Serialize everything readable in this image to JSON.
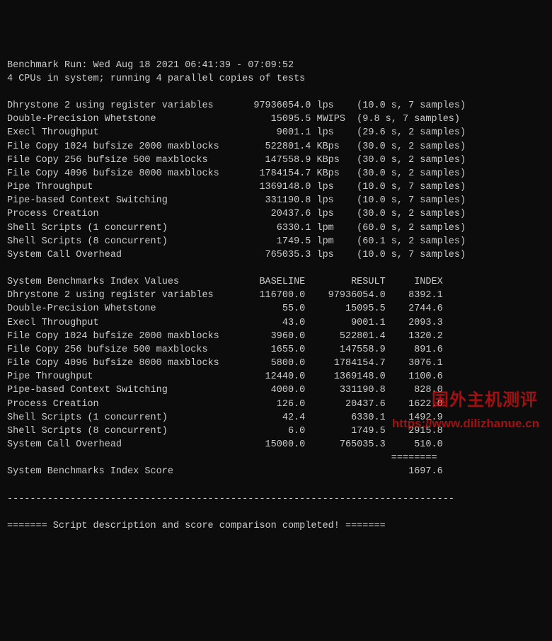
{
  "header": {
    "line1": "Benchmark Run: Wed Aug 18 2021 06:41:39 - 07:09:52",
    "line2": "4 CPUs in system; running 4 parallel copies of tests"
  },
  "separator": "------------------------------------------------------------------------",
  "tests": [
    {
      "name": "Dhrystone 2 using register variables",
      "value": "97936054.0",
      "unit": "lps",
      "timing": "(10.0 s, 7 samples)"
    },
    {
      "name": "Double-Precision Whetstone",
      "value": "15095.5",
      "unit": "MWIPS",
      "timing": "(9.8 s, 7 samples)"
    },
    {
      "name": "Execl Throughput",
      "value": "9001.1",
      "unit": "lps",
      "timing": "(29.6 s, 2 samples)"
    },
    {
      "name": "File Copy 1024 bufsize 2000 maxblocks",
      "value": "522801.4",
      "unit": "KBps",
      "timing": "(30.0 s, 2 samples)"
    },
    {
      "name": "File Copy 256 bufsize 500 maxblocks",
      "value": "147558.9",
      "unit": "KBps",
      "timing": "(30.0 s, 2 samples)"
    },
    {
      "name": "File Copy 4096 bufsize 8000 maxblocks",
      "value": "1784154.7",
      "unit": "KBps",
      "timing": "(30.0 s, 2 samples)"
    },
    {
      "name": "Pipe Throughput",
      "value": "1369148.0",
      "unit": "lps",
      "timing": "(10.0 s, 7 samples)"
    },
    {
      "name": "Pipe-based Context Switching",
      "value": "331190.8",
      "unit": "lps",
      "timing": "(10.0 s, 7 samples)"
    },
    {
      "name": "Process Creation",
      "value": "20437.6",
      "unit": "lps",
      "timing": "(30.0 s, 2 samples)"
    },
    {
      "name": "Shell Scripts (1 concurrent)",
      "value": "6330.1",
      "unit": "lpm",
      "timing": "(60.0 s, 2 samples)"
    },
    {
      "name": "Shell Scripts (8 concurrent)",
      "value": "1749.5",
      "unit": "lpm",
      "timing": "(60.1 s, 2 samples)"
    },
    {
      "name": "System Call Overhead",
      "value": "765035.3",
      "unit": "lps",
      "timing": "(10.0 s, 7 samples)"
    }
  ],
  "index_header": {
    "label": "System Benchmarks Index Values",
    "c1": "BASELINE",
    "c2": "RESULT",
    "c3": "INDEX"
  },
  "index_rows": [
    {
      "name": "Dhrystone 2 using register variables",
      "baseline": "116700.0",
      "result": "97936054.0",
      "index": "8392.1"
    },
    {
      "name": "Double-Precision Whetstone",
      "baseline": "55.0",
      "result": "15095.5",
      "index": "2744.6"
    },
    {
      "name": "Execl Throughput",
      "baseline": "43.0",
      "result": "9001.1",
      "index": "2093.3"
    },
    {
      "name": "File Copy 1024 bufsize 2000 maxblocks",
      "baseline": "3960.0",
      "result": "522801.4",
      "index": "1320.2"
    },
    {
      "name": "File Copy 256 bufsize 500 maxblocks",
      "baseline": "1655.0",
      "result": "147558.9",
      "index": "891.6"
    },
    {
      "name": "File Copy 4096 bufsize 8000 maxblocks",
      "baseline": "5800.0",
      "result": "1784154.7",
      "index": "3076.1"
    },
    {
      "name": "Pipe Throughput",
      "baseline": "12440.0",
      "result": "1369148.0",
      "index": "1100.6"
    },
    {
      "name": "Pipe-based Context Switching",
      "baseline": "4000.0",
      "result": "331190.8",
      "index": "828.0"
    },
    {
      "name": "Process Creation",
      "baseline": "126.0",
      "result": "20437.6",
      "index": "1622.0"
    },
    {
      "name": "Shell Scripts (1 concurrent)",
      "baseline": "42.4",
      "result": "6330.1",
      "index": "1492.9"
    },
    {
      "name": "Shell Scripts (8 concurrent)",
      "baseline": "6.0",
      "result": "1749.5",
      "index": "2915.8"
    },
    {
      "name": "System Call Overhead",
      "baseline": "15000.0",
      "result": "765035.3",
      "index": "510.0"
    }
  ],
  "score_separator": "                                                                   ========",
  "score_row": {
    "label": "System Benchmarks Index Score",
    "value": "1697.6"
  },
  "hr": "------------------------------------------------------------------------------",
  "footer": "======= Script description and score comparison completed! =======",
  "watermark": {
    "title": "国外主机测评",
    "url": "https://www.dilizhanue.cn"
  }
}
